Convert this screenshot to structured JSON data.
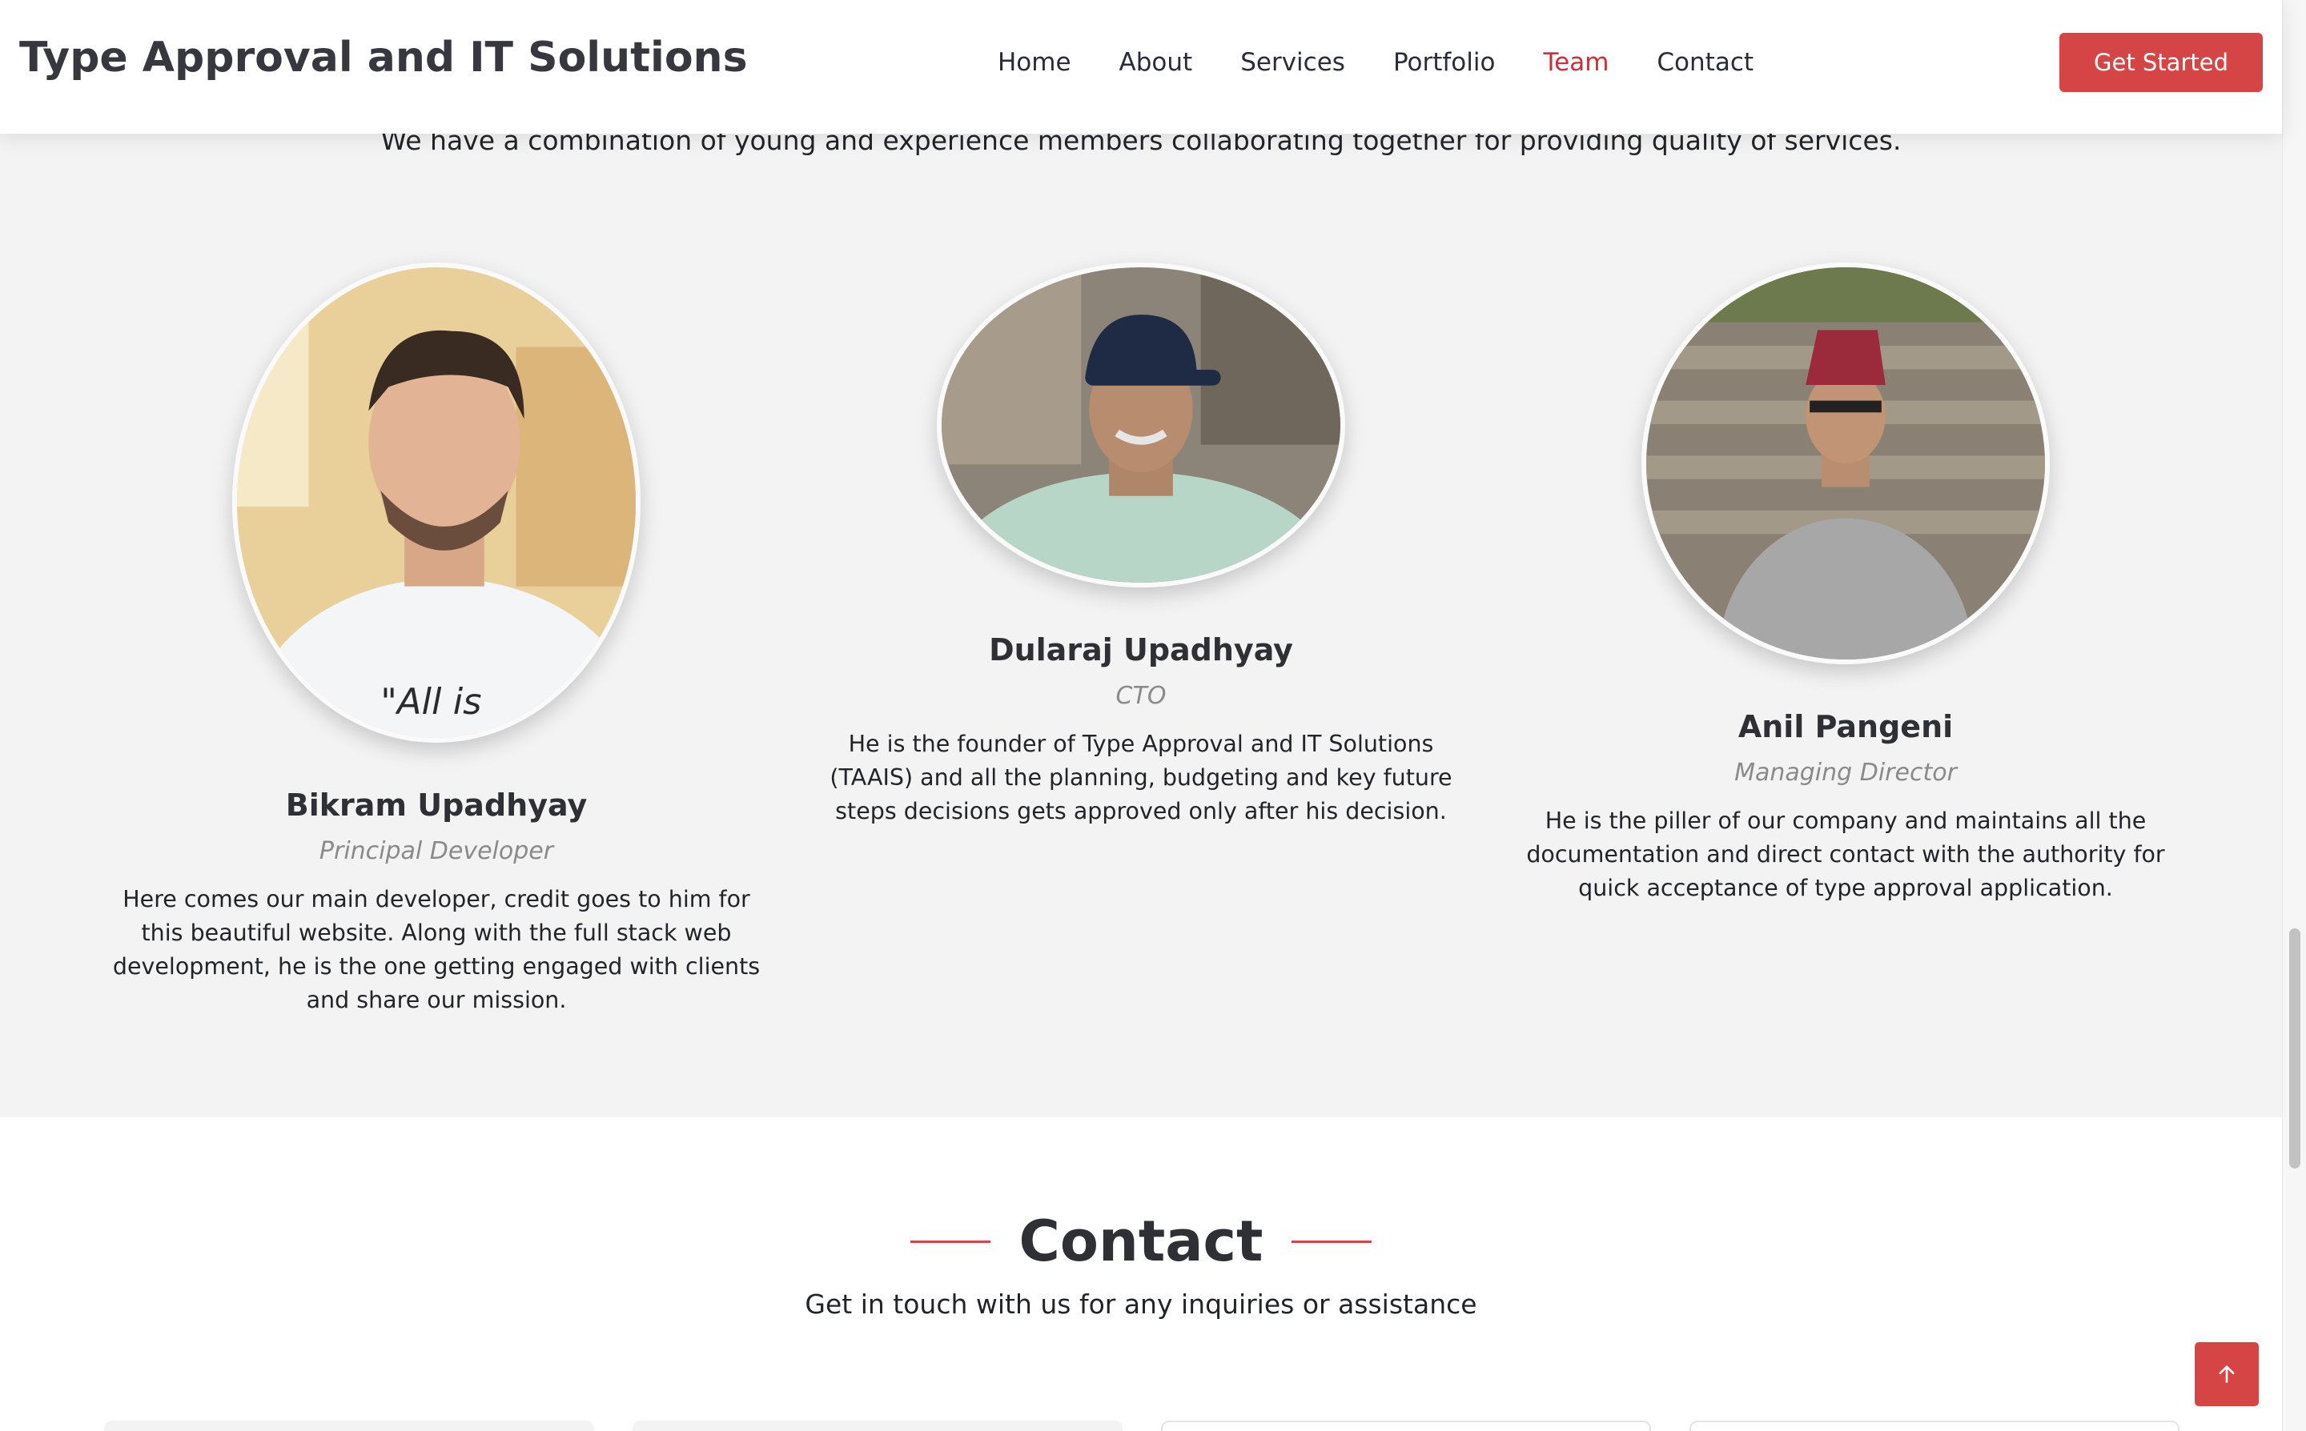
{
  "header": {
    "logo": "Type Approval and IT Solutions",
    "nav": [
      "Home",
      "About",
      "Services",
      "Portfolio",
      "Team",
      "Contact"
    ],
    "active_nav": "Team",
    "cta": "Get Started"
  },
  "team": {
    "subtitle": "We have a combination of young and experience members collaborating together for providing quality of services.",
    "members": [
      {
        "name": "Bikram Upadhyay",
        "role": "Principal Developer",
        "description": "Here comes our main developer, credit goes to him for this beautiful website. Along with the full stack web development, he is the one getting engaged with clients and share our mission."
      },
      {
        "name": "Dularaj Upadhyay",
        "role": "CTO",
        "description": "He is the founder of Type Approval and IT Solutions (TAAIS) and all the planning, budgeting and key future steps decisions gets approved only after his decision."
      },
      {
        "name": "Anil Pangeni",
        "role": "Managing Director",
        "description": "He is the piller of our company and maintains all the documentation and direct contact with the authority for quick acceptance of type approval application."
      }
    ]
  },
  "contact": {
    "title": "Contact",
    "subtitle": "Get in touch with us for any inquiries or assistance"
  },
  "colors": {
    "accent": "#d64545",
    "active_nav": "#c8313a",
    "section_bg": "#f3f3f3"
  },
  "icons": {
    "back_to_top": "arrow-up-icon"
  }
}
